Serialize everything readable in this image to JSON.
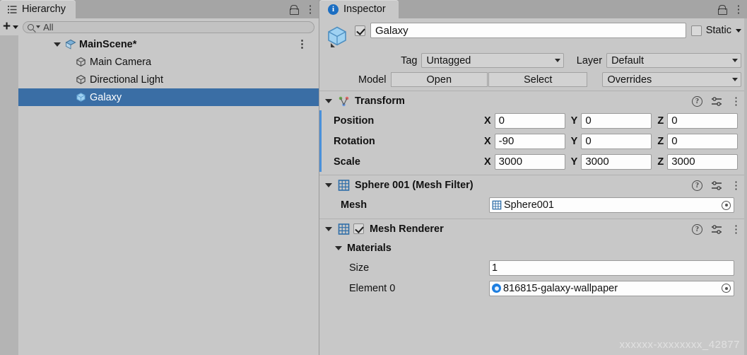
{
  "hierarchy": {
    "tab": {
      "label": "Hierarchy",
      "icon": "list-icon"
    },
    "toolbar": {
      "add_label": "+",
      "search_placeholder": "All",
      "search_value": "All"
    },
    "rows": [
      {
        "label": "MainScene*",
        "icon": "scene-icon",
        "depth": 0,
        "selected": false,
        "expanded": true,
        "kebab": "⋮"
      },
      {
        "label": "Main Camera",
        "icon": "gameobject-icon",
        "depth": 1,
        "selected": false
      },
      {
        "label": "Directional Light",
        "icon": "gameobject-icon",
        "depth": 1,
        "selected": false
      },
      {
        "label": "Galaxy",
        "icon": "prefab-icon",
        "depth": 1,
        "selected": true
      }
    ]
  },
  "inspector": {
    "tab": {
      "label": "Inspector",
      "icon": "info-icon"
    },
    "header": {
      "enabled": true,
      "name_value": "Galaxy",
      "static_label": "Static",
      "tag_label": "Tag",
      "tag_value": "Untagged",
      "layer_label": "Layer",
      "layer_value": "Default",
      "model_label": "Model",
      "open_label": "Open",
      "select_label": "Select",
      "overrides_label": "Overrides"
    },
    "transform": {
      "title": "Transform",
      "icon": "transform-icon",
      "rows": [
        {
          "name": "Position",
          "x": "0",
          "y": "0",
          "z": "0"
        },
        {
          "name": "Rotation",
          "x": "-90",
          "y": "0",
          "z": "0"
        },
        {
          "name": "Scale",
          "x": "3000",
          "y": "3000",
          "z": "3000"
        }
      ],
      "axis_labels": [
        "X",
        "Y",
        "Z"
      ]
    },
    "mesh_filter": {
      "title": "Sphere 001 (Mesh Filter)",
      "icon": "mesh-filter-icon",
      "mesh_label": "Mesh",
      "mesh_value": "Sphere001"
    },
    "mesh_renderer": {
      "title": "Mesh Renderer",
      "icon": "mesh-renderer-icon",
      "enabled": true,
      "materials_label": "Materials",
      "size_label": "Size",
      "size_value": "1",
      "element0_label": "Element 0",
      "element0_value": "816815-galaxy-wallpaper"
    },
    "component_icons": {
      "help": "help-icon",
      "preset": "preset-icon",
      "menu": "kebab-icon"
    }
  },
  "watermark": "xxxxxx-xxxxxxxx_42877",
  "colors": {
    "accent": "#4a90d9",
    "selection": "#3a6ea5",
    "panel": "#c8c8c8",
    "tabbar": "#a5a5a5",
    "field": "#fdfdfd"
  }
}
